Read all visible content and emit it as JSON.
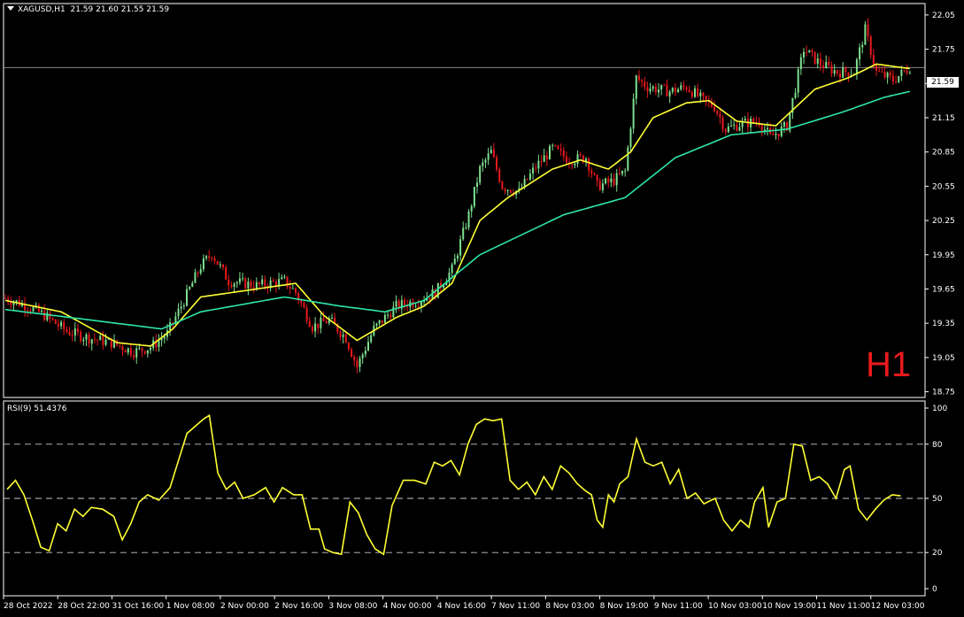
{
  "header": {
    "symbol_label": "XAGUSD,H1",
    "ohlc": "21.59 21.60 21.55 21.59",
    "menu_icon": "triangle-down-icon"
  },
  "timeframe_label": "H1",
  "current_price": "21.59",
  "rsi_label": "RSI(9) 51.4376",
  "colors": {
    "background": "#000000",
    "bull": "#7ee08f",
    "bear": "#e8191b",
    "ma_fast": "#ffff33",
    "ma_slow": "#2fe6a6",
    "rsi": "#ffff33",
    "timeframe": "#e8191b",
    "grid_dash": "#c8c8c8"
  },
  "chart_data": [
    {
      "type": "candlestick",
      "symbol": "XAGUSD",
      "timeframe": "H1",
      "y_ticks": [
        "22.05",
        "21.75",
        "21.45",
        "21.15",
        "20.85",
        "20.55",
        "20.25",
        "19.95",
        "19.65",
        "19.35",
        "19.05",
        "18.75"
      ],
      "ylim": [
        18.7,
        22.15
      ],
      "x_ticks": [
        "28 Oct 2022",
        "28 Oct 22:00",
        "31 Oct 16:00",
        "1 Nov 08:00",
        "2 Nov 00:00",
        "2 Nov 16:00",
        "3 Nov 08:00",
        "4 Nov 00:00",
        "4 Nov 16:00",
        "7 Nov 11:00",
        "8 Nov 03:00",
        "8 Nov 19:00",
        "9 Nov 11:00",
        "10 Nov 03:00",
        "10 Nov 19:00",
        "11 Nov 11:00",
        "12 Nov 03:00"
      ],
      "current_price": 21.59,
      "close_anchors": [
        [
          0,
          19.57
        ],
        [
          8,
          19.5
        ],
        [
          14,
          19.42
        ],
        [
          22,
          19.28
        ],
        [
          30,
          19.22
        ],
        [
          38,
          19.18
        ],
        [
          46,
          19.1
        ],
        [
          52,
          19.14
        ],
        [
          58,
          19.26
        ],
        [
          64,
          19.55
        ],
        [
          70,
          19.85
        ],
        [
          74,
          19.96
        ],
        [
          80,
          19.72
        ],
        [
          90,
          19.68
        ],
        [
          100,
          19.72
        ],
        [
          104,
          19.62
        ],
        [
          110,
          19.32
        ],
        [
          116,
          19.38
        ],
        [
          122,
          19.22
        ],
        [
          126,
          18.97
        ],
        [
          132,
          19.3
        ],
        [
          140,
          19.5
        ],
        [
          148,
          19.55
        ],
        [
          154,
          19.62
        ],
        [
          160,
          19.82
        ],
        [
          166,
          20.3
        ],
        [
          170,
          20.7
        ],
        [
          174,
          20.85
        ],
        [
          178,
          20.55
        ],
        [
          184,
          20.5
        ],
        [
          190,
          20.72
        ],
        [
          196,
          20.88
        ],
        [
          202,
          20.78
        ],
        [
          208,
          20.8
        ],
        [
          212,
          20.55
        ],
        [
          218,
          20.6
        ],
        [
          222,
          20.68
        ],
        [
          226,
          21.5
        ],
        [
          230,
          21.42
        ],
        [
          238,
          21.38
        ],
        [
          244,
          21.42
        ],
        [
          250,
          21.3
        ],
        [
          254,
          21.25
        ],
        [
          258,
          21.05
        ],
        [
          264,
          21.1
        ],
        [
          270,
          21.12
        ],
        [
          274,
          20.98
        ],
        [
          280,
          21.08
        ],
        [
          286,
          21.75
        ],
        [
          292,
          21.62
        ],
        [
          298,
          21.55
        ],
        [
          304,
          21.55
        ],
        [
          308,
          21.92
        ],
        [
          312,
          21.55
        ],
        [
          318,
          21.48
        ],
        [
          324,
          21.59
        ]
      ],
      "series": [
        {
          "name": "",
          "type": "moving-average",
          "color": "#ffff33",
          "values": [
            [
              0,
              19.55
            ],
            [
              20,
              19.45
            ],
            [
              40,
              19.18
            ],
            [
              52,
              19.15
            ],
            [
              60,
              19.3
            ],
            [
              70,
              19.58
            ],
            [
              90,
              19.65
            ],
            [
              104,
              19.7
            ],
            [
              114,
              19.42
            ],
            [
              126,
              19.2
            ],
            [
              140,
              19.4
            ],
            [
              150,
              19.5
            ],
            [
              160,
              19.7
            ],
            [
              170,
              20.25
            ],
            [
              180,
              20.45
            ],
            [
              196,
              20.7
            ],
            [
              206,
              20.78
            ],
            [
              216,
              20.7
            ],
            [
              224,
              20.85
            ],
            [
              232,
              21.15
            ],
            [
              244,
              21.28
            ],
            [
              252,
              21.3
            ],
            [
              262,
              21.12
            ],
            [
              276,
              21.08
            ],
            [
              290,
              21.4
            ],
            [
              302,
              21.5
            ],
            [
              312,
              21.62
            ],
            [
              324,
              21.58
            ]
          ]
        },
        {
          "name": "",
          "type": "moving-average",
          "color": "#2fe6a6",
          "values": [
            [
              0,
              19.47
            ],
            [
              30,
              19.38
            ],
            [
              56,
              19.3
            ],
            [
              70,
              19.45
            ],
            [
              100,
              19.58
            ],
            [
              120,
              19.5
            ],
            [
              136,
              19.45
            ],
            [
              150,
              19.55
            ],
            [
              170,
              19.95
            ],
            [
              200,
              20.3
            ],
            [
              222,
              20.45
            ],
            [
              240,
              20.8
            ],
            [
              260,
              21.0
            ],
            [
              280,
              21.05
            ],
            [
              300,
              21.2
            ],
            [
              315,
              21.33
            ],
            [
              324,
              21.38
            ]
          ]
        }
      ]
    },
    {
      "type": "line",
      "name": "RSI(9)",
      "value": 51.4376,
      "ylim": [
        0,
        100
      ],
      "y_ticks": [
        "100",
        "80",
        "50",
        "20",
        "0"
      ],
      "levels": [
        80,
        50,
        20
      ],
      "values": [
        [
          0,
          55
        ],
        [
          3,
          60
        ],
        [
          6,
          52
        ],
        [
          9,
          38
        ],
        [
          12,
          23
        ],
        [
          15,
          21
        ],
        [
          18,
          36
        ],
        [
          21,
          32
        ],
        [
          24,
          44
        ],
        [
          27,
          40
        ],
        [
          30,
          45
        ],
        [
          34,
          44
        ],
        [
          38,
          40
        ],
        [
          41,
          27
        ],
        [
          44,
          36
        ],
        [
          47,
          48
        ],
        [
          50,
          52
        ],
        [
          54,
          49
        ],
        [
          58,
          56
        ],
        [
          61,
          71
        ],
        [
          64,
          86
        ],
        [
          67,
          90
        ],
        [
          70,
          94
        ],
        [
          72,
          96
        ],
        [
          75,
          64
        ],
        [
          78,
          55
        ],
        [
          81,
          59
        ],
        [
          84,
          50
        ],
        [
          88,
          52
        ],
        [
          92,
          56
        ],
        [
          95,
          48
        ],
        [
          98,
          56
        ],
        [
          102,
          52
        ],
        [
          105,
          52
        ],
        [
          108,
          33
        ],
        [
          111,
          33
        ],
        [
          113,
          22
        ],
        [
          116,
          20
        ],
        [
          119,
          19
        ],
        [
          122,
          48
        ],
        [
          125,
          42
        ],
        [
          128,
          30
        ],
        [
          131,
          22
        ],
        [
          134,
          19
        ],
        [
          137,
          46
        ],
        [
          141,
          60
        ],
        [
          145,
          60
        ],
        [
          149,
          58
        ],
        [
          152,
          70
        ],
        [
          155,
          68
        ],
        [
          158,
          71
        ],
        [
          161,
          63
        ],
        [
          164,
          80
        ],
        [
          167,
          91
        ],
        [
          170,
          94
        ],
        [
          173,
          93
        ],
        [
          176,
          94
        ],
        [
          179,
          60
        ],
        [
          182,
          55
        ],
        [
          185,
          59
        ],
        [
          188,
          52
        ],
        [
          191,
          62
        ],
        [
          194,
          55
        ],
        [
          197,
          68
        ],
        [
          200,
          64
        ],
        [
          203,
          58
        ],
        [
          206,
          54
        ],
        [
          208,
          52
        ],
        [
          210,
          38
        ],
        [
          212,
          34
        ],
        [
          214,
          52
        ],
        [
          216,
          48
        ],
        [
          218,
          58
        ],
        [
          221,
          62
        ],
        [
          224,
          83
        ],
        [
          227,
          70
        ],
        [
          230,
          68
        ],
        [
          233,
          70
        ],
        [
          236,
          58
        ],
        [
          239,
          66
        ],
        [
          242,
          50
        ],
        [
          245,
          53
        ],
        [
          248,
          47
        ],
        [
          252,
          50
        ],
        [
          255,
          38
        ],
        [
          258,
          32
        ],
        [
          261,
          38
        ],
        [
          264,
          34
        ],
        [
          266,
          48
        ],
        [
          269,
          56
        ],
        [
          271,
          34
        ],
        [
          274,
          48
        ],
        [
          277,
          50
        ],
        [
          280,
          80
        ],
        [
          283,
          79
        ],
        [
          286,
          60
        ],
        [
          289,
          62
        ],
        [
          292,
          58
        ],
        [
          295,
          50
        ],
        [
          298,
          66
        ],
        [
          300,
          68
        ],
        [
          303,
          44
        ],
        [
          306,
          38
        ],
        [
          309,
          44
        ],
        [
          312,
          49
        ],
        [
          315,
          52
        ],
        [
          318,
          51.4
        ]
      ]
    }
  ]
}
